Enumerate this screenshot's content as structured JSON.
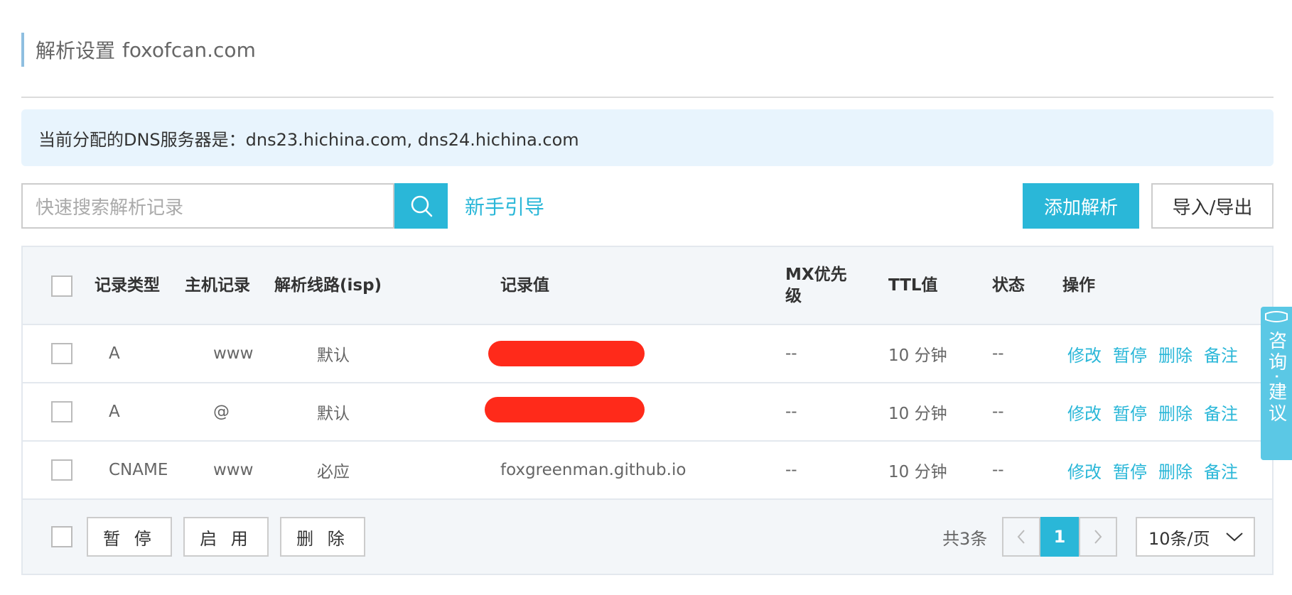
{
  "header": {
    "title": "解析设置",
    "domain": "foxofcan.com"
  },
  "dns_banner": {
    "text": "当前分配的DNS服务器是：dns23.hichina.com, dns24.hichina.com"
  },
  "toolbar": {
    "search_placeholder": "快速搜索解析记录",
    "search_icon": "search-icon",
    "guide_label": "新手引导",
    "add_label": "添加解析",
    "import_export_label": "导入/导出"
  },
  "table": {
    "headers": {
      "type": "记录类型",
      "host": "主机记录",
      "line": "解析线路(isp)",
      "value": "记录值",
      "mx": "MX优先级",
      "ttl": "TTL值",
      "status": "状态",
      "ops": "操作"
    },
    "rows": [
      {
        "type": "A",
        "host": "www",
        "line": "默认",
        "value": "",
        "value_redacted": true,
        "mx": "--",
        "ttl": "10 分钟",
        "status": "--"
      },
      {
        "type": "A",
        "host": "@",
        "line": "默认",
        "value": "",
        "value_redacted": true,
        "mx": "--",
        "ttl": "10 分钟",
        "status": "--"
      },
      {
        "type": "CNAME",
        "host": "www",
        "line": "必应",
        "value": "foxgreenman.github.io",
        "value_redacted": false,
        "mx": "--",
        "ttl": "10 分钟",
        "status": "--"
      }
    ],
    "actions": {
      "edit": "修改",
      "pause": "暂停",
      "delete": "删除",
      "note": "备注"
    }
  },
  "footer": {
    "pause_label": "暂 停",
    "enable_label": "启 用",
    "delete_label": "删 除",
    "total_text": "共3条",
    "prev_icon": "chevron-left-icon",
    "current_page": "1",
    "next_icon": "chevron-right-icon",
    "page_size": "10条/页"
  },
  "consult": {
    "text": "咨询·建议"
  },
  "colors": {
    "accent": "#2ab7d8",
    "banner_bg": "#e8f4fd",
    "header_bg": "#f3f6f9",
    "redaction": "#ff2a1a"
  }
}
